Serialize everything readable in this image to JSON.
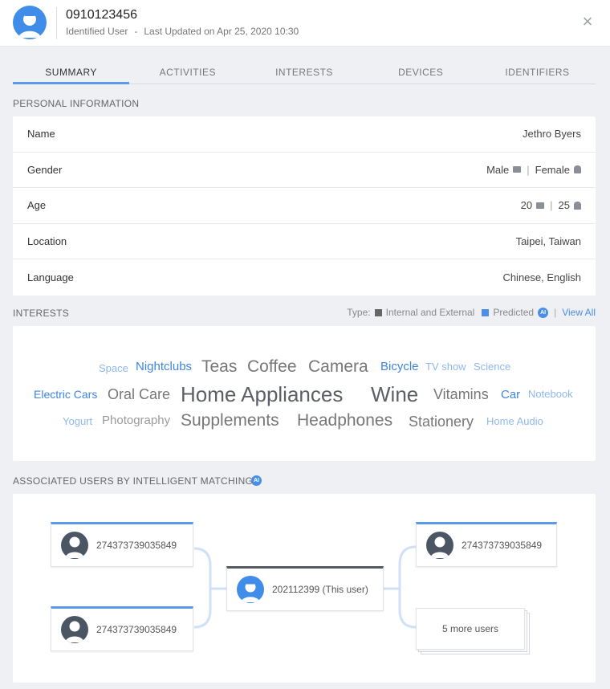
{
  "header": {
    "title": "0910123456",
    "user_type": "Identified User",
    "separator": "-",
    "last_updated": "Last Updated on Apr 25, 2020 10:30",
    "close_glyph": "×"
  },
  "tabs": [
    {
      "label": "SUMMARY",
      "active": true
    },
    {
      "label": "ACTIVITIES",
      "active": false
    },
    {
      "label": "INTERESTS",
      "active": false
    },
    {
      "label": "DEVICES",
      "active": false
    },
    {
      "label": "IDENTIFIERS",
      "active": false
    }
  ],
  "personal": {
    "heading": "PERSONAL INFORMATION",
    "rows": {
      "name": {
        "label": "Name",
        "value": "Jethro Byers"
      },
      "gender": {
        "label": "Gender",
        "value_a": "Male",
        "value_b": "Female"
      },
      "age": {
        "label": "Age",
        "value_a": "20",
        "value_b": "25"
      },
      "location": {
        "label": "Location",
        "value": "Taipei, Taiwan"
      },
      "language": {
        "label": "Language",
        "value": "Chinese, English"
      }
    },
    "pipe": "|"
  },
  "interests": {
    "heading": "INTERESTS",
    "legend": {
      "type_label": "Type:",
      "internal_label": "Internal and External",
      "predicted_label": "Predicted",
      "ai_badge": "AI",
      "pipe": "|",
      "view_all": "View All"
    },
    "words": [
      {
        "text": "Space",
        "tone": "predicted"
      },
      {
        "text": "Nightclubs",
        "tone": "predicted"
      },
      {
        "text": "Teas",
        "tone": "internal"
      },
      {
        "text": "Coffee",
        "tone": "internal"
      },
      {
        "text": "Camera",
        "tone": "internal"
      },
      {
        "text": "Bicycle",
        "tone": "predicted"
      },
      {
        "text": "TV show",
        "tone": "predicted"
      },
      {
        "text": "Science",
        "tone": "predicted"
      },
      {
        "text": "Electric Cars",
        "tone": "predicted"
      },
      {
        "text": "Oral Care",
        "tone": "internal"
      },
      {
        "text": "Home Appliances",
        "tone": "internal"
      },
      {
        "text": "Wine",
        "tone": "internal"
      },
      {
        "text": "Vitamins",
        "tone": "internal"
      },
      {
        "text": "Car",
        "tone": "predicted"
      },
      {
        "text": "Notebook",
        "tone": "predicted"
      },
      {
        "text": "Yogurt",
        "tone": "predicted"
      },
      {
        "text": "Photography",
        "tone": "internal"
      },
      {
        "text": "Supplements",
        "tone": "internal"
      },
      {
        "text": "Headphones",
        "tone": "internal"
      },
      {
        "text": "Stationery",
        "tone": "internal"
      },
      {
        "text": "Home Audio",
        "tone": "predicted"
      }
    ]
  },
  "associated": {
    "heading": "ASSOCIATED USERS BY INTELLIGENT MATCHING",
    "ai_badge": "AI",
    "left_users": [
      "274373739035849",
      "274373739035849"
    ],
    "center_user": "202112399 (This user)",
    "right_user": "274373739035849",
    "more_users": "5 more users"
  },
  "colors": {
    "accent": "#5a9ae9",
    "internal_square": "#666666",
    "predicted_square": "#4a8ee6",
    "avatar_blue": "#3f8de8",
    "avatar_dark": "#4b5563"
  },
  "icons": {
    "avatar": "user-avatar-icon",
    "close": "close-icon",
    "internal": "internal-data-icon",
    "predicted": "predicted-data-icon"
  }
}
